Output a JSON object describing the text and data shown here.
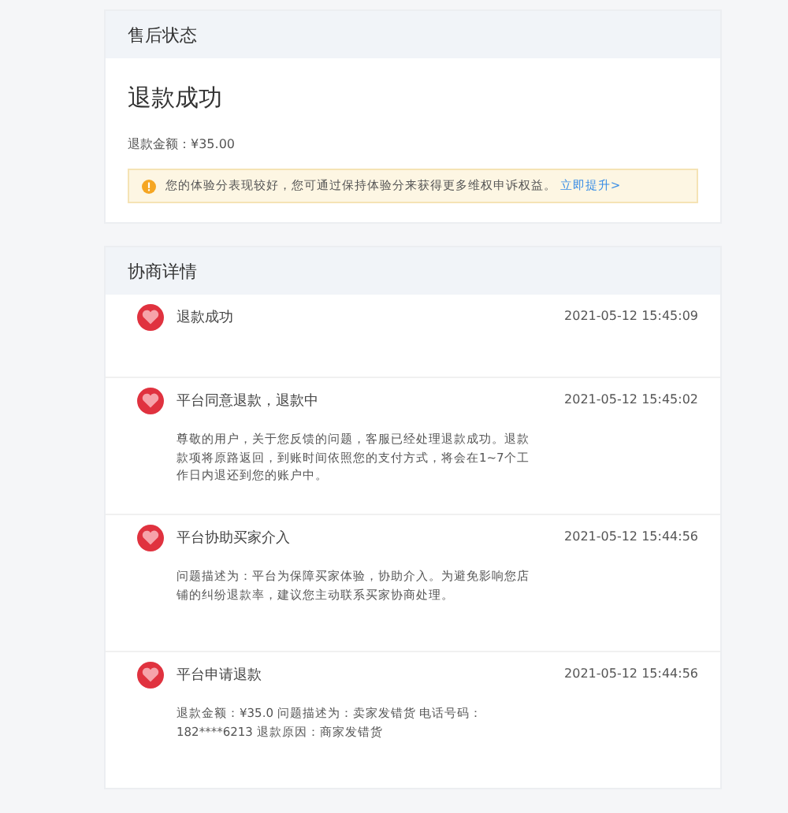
{
  "status_card": {
    "title": "售后状态",
    "status": "退款成功",
    "amount": "退款金额：¥35.00",
    "notice": {
      "text": "您的体验分表现较好，您可通过保持体验分来获得更多维权申诉权益。",
      "link": "立即提升>"
    }
  },
  "details_card": {
    "title": "协商详情",
    "events": [
      {
        "title": "退款成功",
        "time": "2021-05-12 15:45:09"
      },
      {
        "title": "平台同意退款，退款中",
        "time": "2021-05-12 15:45:02",
        "body": "尊敬的用户，关于您反馈的问题，客服已经处理退款成功。退款款项将原路返回，到账时间依照您的支付方式，将会在1~7个工作日内退还到您的账户中。"
      },
      {
        "title": "平台协助买家介入",
        "time": "2021-05-12 15:44:56",
        "body": "问题描述为：平台为保障买家体验，协助介入。为避免影响您店铺的纠纷退款率，建议您主动联系买家协商处理。"
      },
      {
        "title": "平台申请退款",
        "time": "2021-05-12 15:44:56",
        "body": "退款金额：¥35.0 问题描述为：卖家发错货 电话号码：182****6213 退款原因：商家发错货"
      }
    ]
  }
}
